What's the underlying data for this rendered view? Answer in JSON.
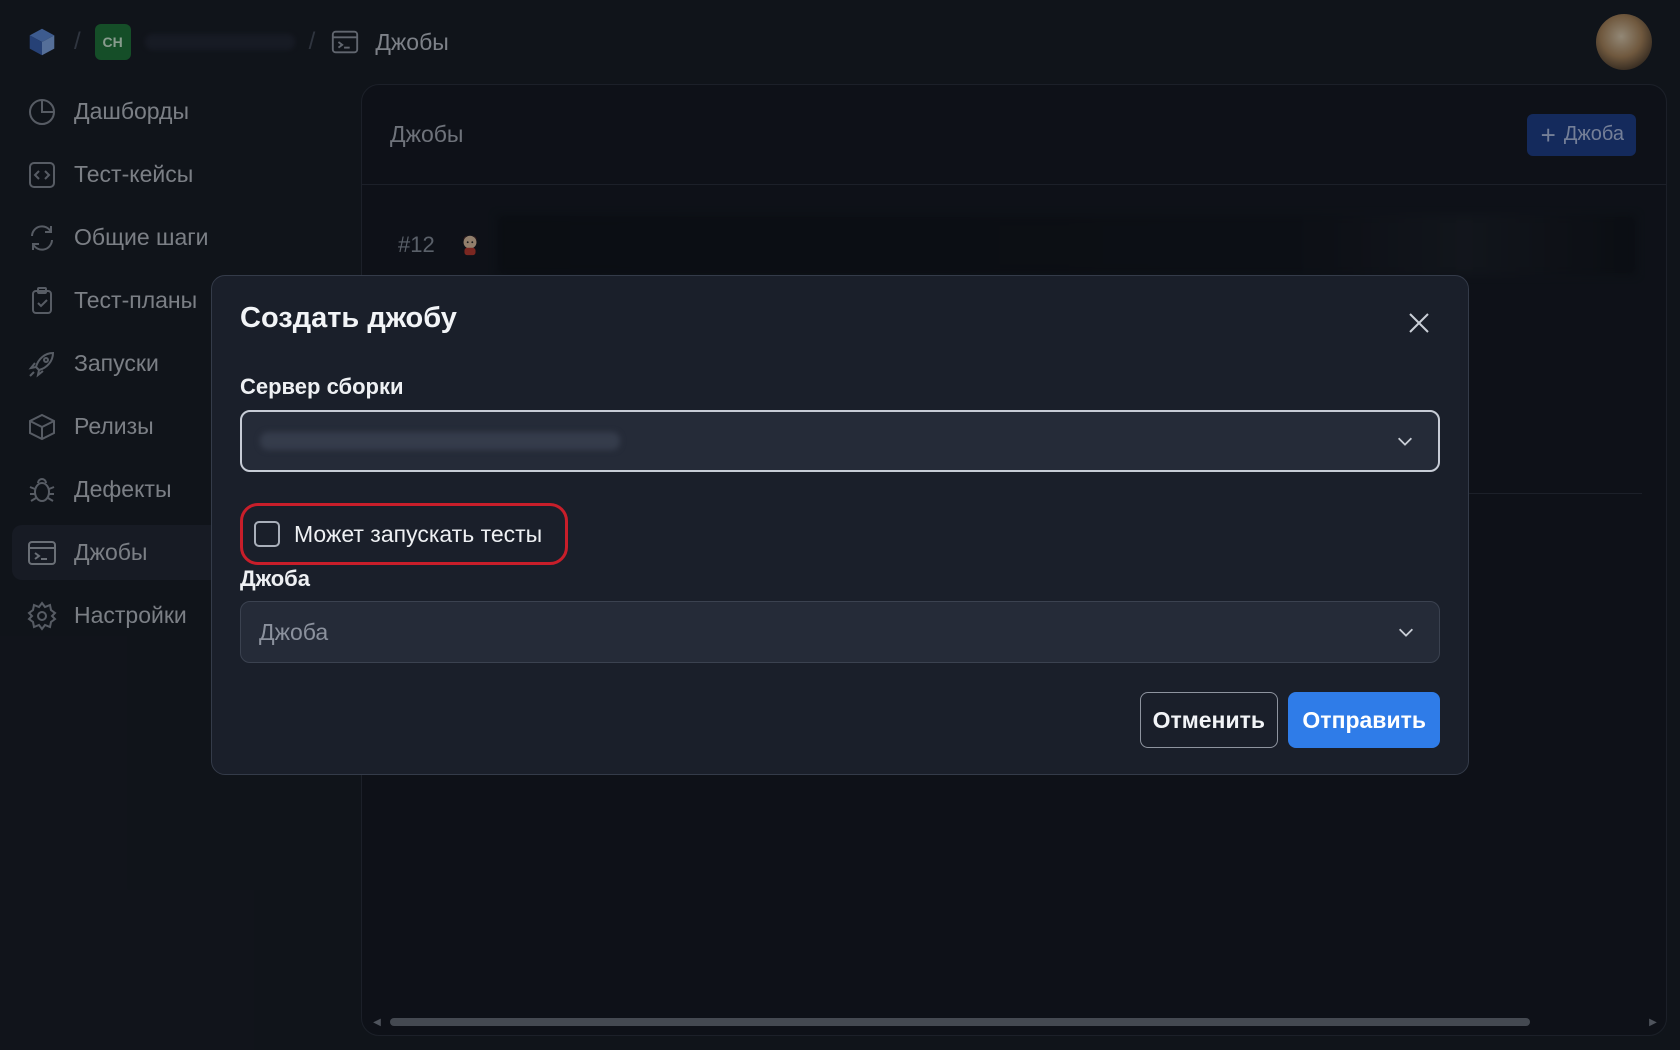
{
  "colors": {
    "background": "#181c25",
    "panel": "#141821",
    "modal": "#1a1f2a",
    "accent": "#2f7ce8",
    "project_badge": "#1f7a3a",
    "highlight": "#c81e2a"
  },
  "header": {
    "logo_icon": "cube-logo-icon",
    "project_badge": "CH",
    "current_page_icon": "terminal-icon",
    "current_page": "Джобы"
  },
  "sidebar": {
    "items": [
      {
        "label": "Дашборды",
        "icon": "pie-chart-icon"
      },
      {
        "label": "Тест-кейсы",
        "icon": "code-icon"
      },
      {
        "label": "Общие шаги",
        "icon": "refresh-icon"
      },
      {
        "label": "Тест-планы",
        "icon": "clipboard-check-icon"
      },
      {
        "label": "Запуски",
        "icon": "rocket-icon"
      },
      {
        "label": "Релизы",
        "icon": "package-icon"
      },
      {
        "label": "Дефекты",
        "icon": "bug-icon"
      },
      {
        "label": "Джобы",
        "icon": "terminal-icon",
        "active": true
      },
      {
        "label": "Настройки",
        "icon": "gear-icon"
      }
    ]
  },
  "main": {
    "title": "Джобы",
    "add_button": "Джоба",
    "jobs": [
      {
        "number": "#12"
      }
    ]
  },
  "modal": {
    "title": "Создать джобу",
    "server_label": "Сервер сборки",
    "checkbox_label": "Может запускать тесты",
    "checkbox_checked": false,
    "job_label": "Джоба",
    "job_placeholder": "Джоба",
    "cancel_label": "Отменить",
    "submit_label": "Отправить"
  }
}
